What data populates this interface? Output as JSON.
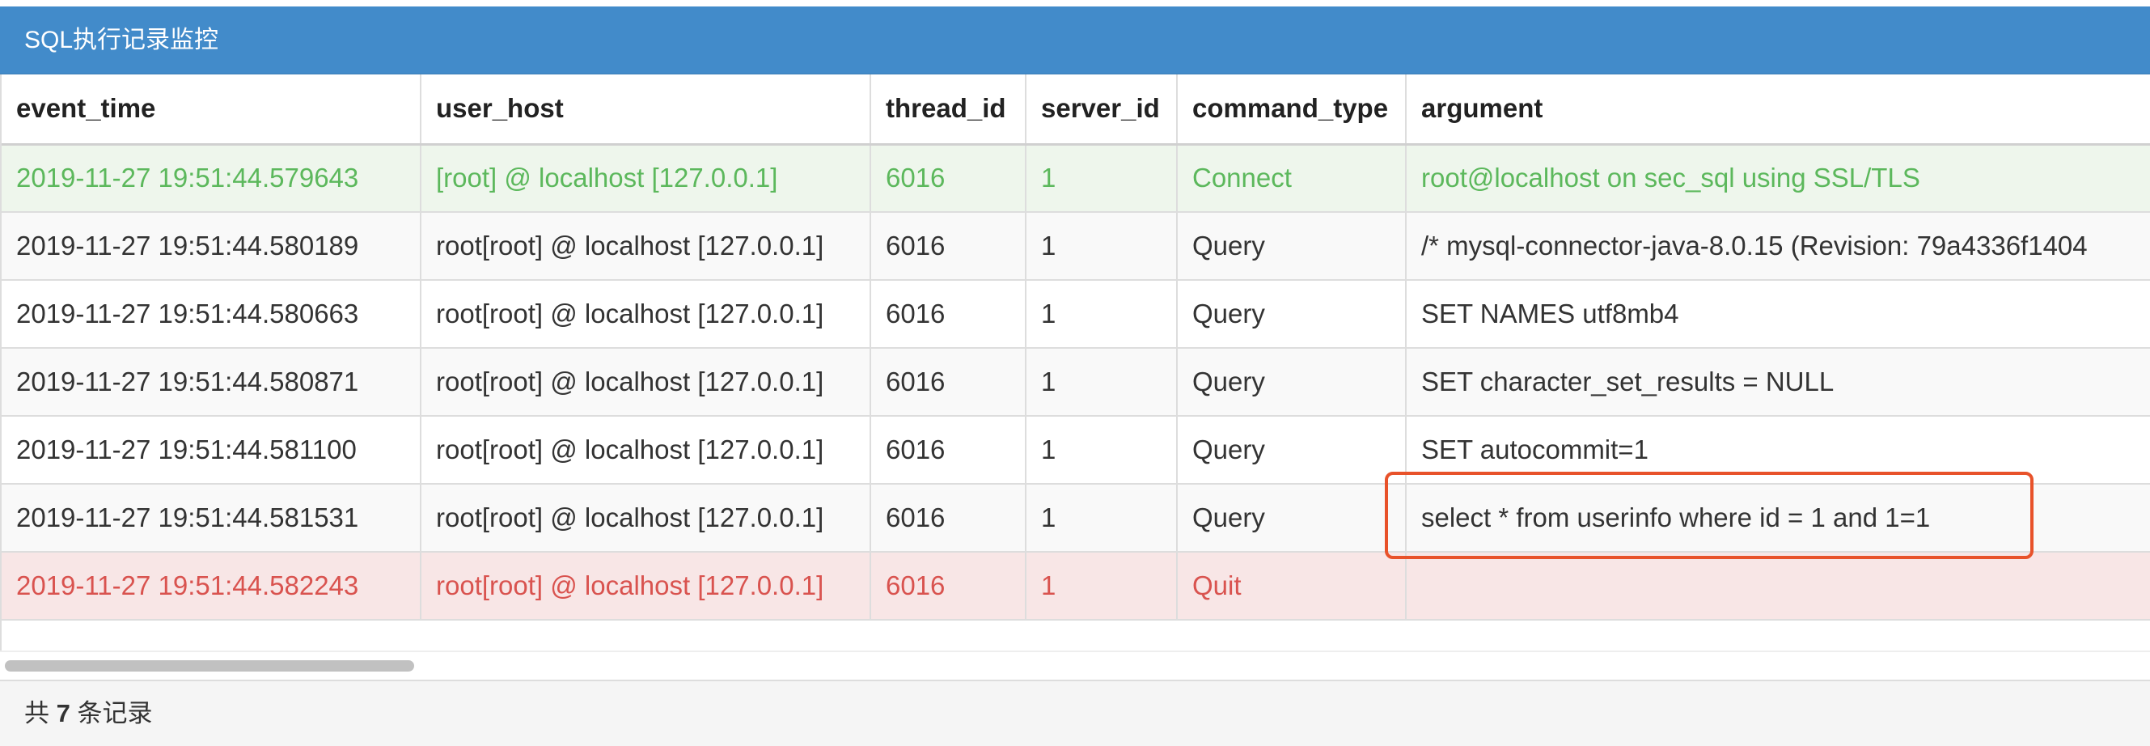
{
  "panel": {
    "title": "SQL执行记录监控",
    "header_color": "#428bca"
  },
  "table": {
    "columns": [
      "event_time",
      "user_host",
      "thread_id",
      "server_id",
      "command_type",
      "argument"
    ],
    "rows": [
      {
        "event_time": "2019-11-27 19:51:44.579643",
        "user_host": "[root] @ localhost [127.0.0.1]",
        "thread_id": "6016",
        "server_id": "1",
        "command_type": "Connect",
        "argument": "root@localhost on sec_sql using SSL/TLS",
        "status": "success"
      },
      {
        "event_time": "2019-11-27 19:51:44.580189",
        "user_host": "root[root] @ localhost [127.0.0.1]",
        "thread_id": "6016",
        "server_id": "1",
        "command_type": "Query",
        "argument": "/* mysql-connector-java-8.0.15 (Revision: 79a4336f1404",
        "status": "normal"
      },
      {
        "event_time": "2019-11-27 19:51:44.580663",
        "user_host": "root[root] @ localhost [127.0.0.1]",
        "thread_id": "6016",
        "server_id": "1",
        "command_type": "Query",
        "argument": "SET NAMES utf8mb4",
        "status": "normal"
      },
      {
        "event_time": "2019-11-27 19:51:44.580871",
        "user_host": "root[root] @ localhost [127.0.0.1]",
        "thread_id": "6016",
        "server_id": "1",
        "command_type": "Query",
        "argument": "SET character_set_results = NULL",
        "status": "normal"
      },
      {
        "event_time": "2019-11-27 19:51:44.581100",
        "user_host": "root[root] @ localhost [127.0.0.1]",
        "thread_id": "6016",
        "server_id": "1",
        "command_type": "Query",
        "argument": "SET autocommit=1",
        "status": "normal"
      },
      {
        "event_time": "2019-11-27 19:51:44.581531",
        "user_host": "root[root] @ localhost [127.0.0.1]",
        "thread_id": "6016",
        "server_id": "1",
        "command_type": "Query",
        "argument": "select * from userinfo where id = 1 and 1=1",
        "status": "normal"
      },
      {
        "event_time": "2019-11-27 19:51:44.582243",
        "user_host": "root[root] @ localhost [127.0.0.1]",
        "thread_id": "6016",
        "server_id": "1",
        "command_type": "Quit",
        "argument": "",
        "status": "danger"
      }
    ],
    "success_color": "#5cb85c",
    "danger_color": "#d9534f",
    "highlight_color": "#e8522a"
  },
  "footer": {
    "prefix": "共",
    "count": "7",
    "suffix": "条记录"
  }
}
